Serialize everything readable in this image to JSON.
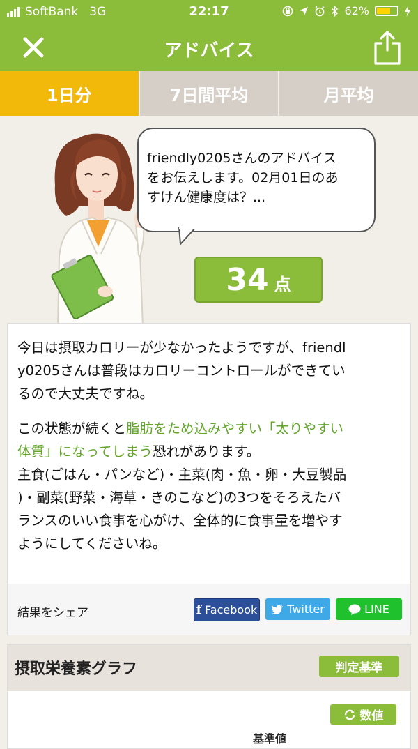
{
  "status_bar": {
    "carrier": "SoftBank",
    "network": "3G",
    "time": "22:17",
    "battery": "62%"
  },
  "nav": {
    "title": "アドバイス"
  },
  "tabs": [
    {
      "label": "1日分",
      "active": true
    },
    {
      "label": "7日間平均",
      "active": false
    },
    {
      "label": "月平均",
      "active": false
    }
  ],
  "bubble": {
    "lines": [
      "friendly0205さんのアドバイス",
      "をお伝えします。02月01日のあ",
      "すけん健康度は？..."
    ]
  },
  "score": {
    "value": "34",
    "unit": "点"
  },
  "advice": {
    "p1_lines": [
      "今日は摂取カロリーが少なかったようですが、friendl",
      "y0205さんは普段はカロリーコントロールができてい",
      "るので大丈夫ですね。"
    ],
    "p2_l1_a": "この状態が続くと",
    "p2_l1_b": "脂肪をため込みやすい「太りやすい",
    "p2_l2_a": "体質」になってしまう",
    "p2_l2_b": "恐れがあります。",
    "p3_lines": [
      "主食(ごはん・パンなど)・主菜(肉・魚・卵・大豆製品",
      ")・副菜(野菜・海草・きのこなど)の3つをそろえたバ",
      "ランスのいい食事を心がけ、全体的に食事量を増やす",
      "ようにしてくださいね。"
    ]
  },
  "share": {
    "label": "結果をシェア",
    "facebook": "Facebook",
    "twitter": "Twitter",
    "line": "LINE"
  },
  "graph": {
    "title": "摂取栄養素グラフ",
    "criteria_button": "判定基準",
    "value_button": "数値",
    "base_label": "基準値"
  },
  "colors": {
    "brand_green": "#8cbd3a",
    "tab_active": "#f2b80a",
    "highlight": "#62a52a"
  }
}
